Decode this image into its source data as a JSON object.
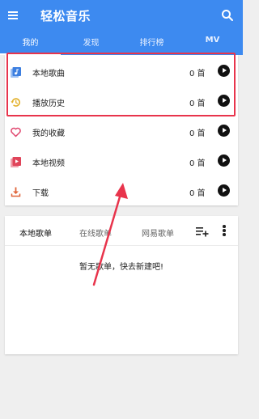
{
  "app": {
    "title": "轻松音乐"
  },
  "tabs": [
    {
      "label": "我的"
    },
    {
      "label": "发现"
    },
    {
      "label": "排行榜"
    },
    {
      "label": "MV"
    }
  ],
  "library": {
    "items": [
      {
        "label": "本地歌曲",
        "count": "0 首",
        "icon": "local-music-icon"
      },
      {
        "label": "播放历史",
        "count": "0 首",
        "icon": "history-icon"
      },
      {
        "label": "我的收藏",
        "count": "0 首",
        "icon": "heart-icon"
      },
      {
        "label": "本地视频",
        "count": "0 首",
        "icon": "video-icon"
      },
      {
        "label": "下载",
        "count": "0 首",
        "icon": "download-icon"
      }
    ]
  },
  "playlists": {
    "tabs": [
      {
        "label": "本地歌单"
      },
      {
        "label": "在线歌单"
      },
      {
        "label": "网易歌单"
      }
    ],
    "empty_message": "暂无歌单，快去新建吧!"
  },
  "colors": {
    "app_bar": "#3d8af0",
    "highlight_annotation": "#e8344c",
    "local_music_icon": "#3d7fe0",
    "history_icon": "#e2b02a",
    "heart_icon": "#e0466e",
    "video_icon": "#e0455a",
    "download_icon": "#e0653a"
  }
}
